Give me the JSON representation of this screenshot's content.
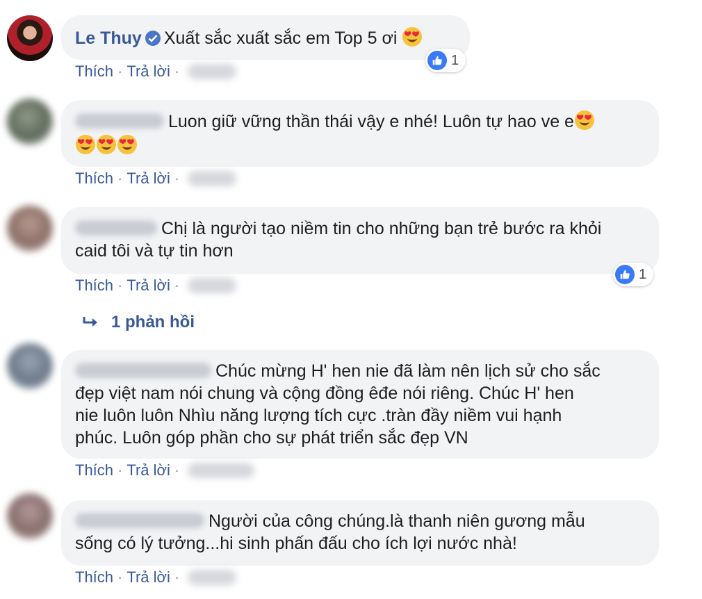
{
  "comments": [
    {
      "name": "Le Thuy",
      "verified": true,
      "text": "Xuất sắc xuất sắc em Top 5 ơi",
      "reaction_count": "1",
      "like_label": "Thích",
      "reply_label": "Trả lời"
    },
    {
      "text": "Luon giữ vững thần thái vậy e nhé! Luôn tự hao ve e",
      "like_label": "Thích",
      "reply_label": "Trả lời"
    },
    {
      "text_line1": "Chị là người tạo niềm tin cho những bạn trẻ bước ra khỏi",
      "text_line2": "caid tôi và tự tin hơn",
      "reaction_count": "1",
      "like_label": "Thích",
      "reply_label": "Trả lời",
      "replies_label": "1 phản hồi"
    },
    {
      "text_line1": "Chúc mừng H' hen nie đã làm nên lịch sử cho sắc",
      "text_line2": "đẹp việt nam nói chung và cộng đồng êđe nói riêng. Chúc H' hen",
      "text_line3": "nie luôn luôn Nhìu năng lượng tích cực .tràn đầy niềm vui hạnh",
      "text_line4": "phúc. Luôn góp phần cho sự phát triển sắc đẹp VN",
      "like_label": "Thích",
      "reply_label": "Trả lời"
    },
    {
      "text_line1": "Người của công chúng.là thanh niên gương mẫu",
      "text_line2": "sống có lý tưởng...hi sinh phấn đấu cho ích lợi nước nhà!",
      "like_label": "Thích",
      "reply_label": "Trả lời"
    }
  ],
  "colors": {
    "link": "#385898",
    "bubble": "#f2f3f5",
    "like_blue": "#3b7af6"
  },
  "icons": [
    "heart-eyes-emoji",
    "verified-badge-icon",
    "like-thumb-icon",
    "reply-arrow-icon"
  ]
}
